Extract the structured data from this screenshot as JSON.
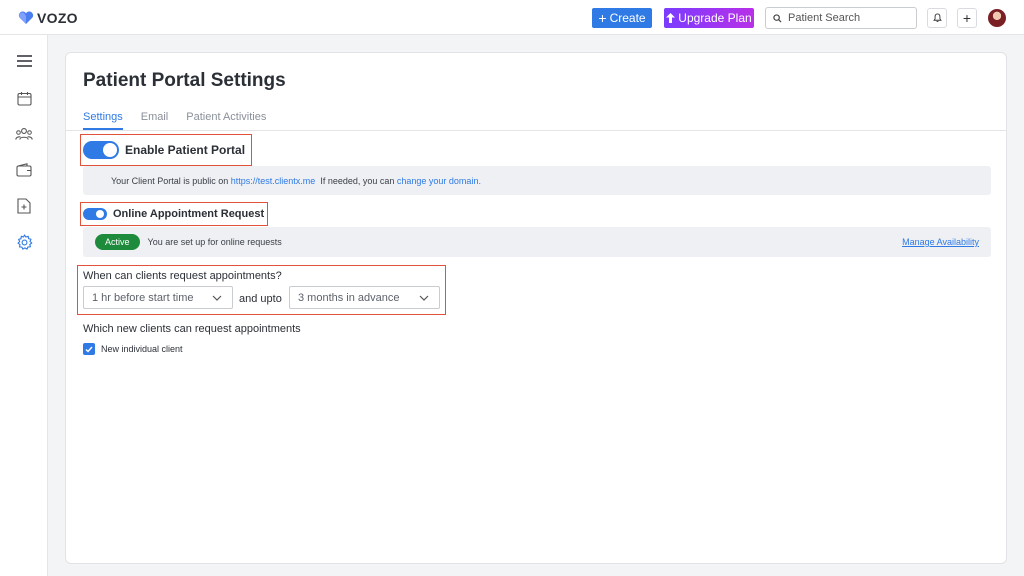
{
  "app": {
    "brand": "VOZO"
  },
  "header": {
    "create_label": "Create",
    "upgrade_label": "Upgrade Plan",
    "search_placeholder": "Patient Search"
  },
  "page": {
    "title": "Patient Portal Settings",
    "tabs": [
      {
        "label": "Settings",
        "active": true
      },
      {
        "label": "Email",
        "active": false
      },
      {
        "label": "Patient Activities",
        "active": false
      }
    ]
  },
  "portal": {
    "toggle_label": "Enable Patient Portal",
    "enabled": true,
    "info_prefix": "Your Client Portal is public on",
    "url": "https://test.clientx.me",
    "info_middle": "If needed, you can",
    "change_link": "change your domain."
  },
  "appointment": {
    "toggle_label": "Online Appointment Request",
    "enabled": true,
    "status_badge": "Active",
    "status_text": "You are set up for online requests",
    "manage_link": "Manage Availability"
  },
  "timing": {
    "question": "When can clients request appointments?",
    "start_value": "1 hr before start time",
    "connector": "and upto",
    "end_value": "3 months in advance"
  },
  "clients": {
    "question": "Which new clients can request appointments",
    "option_label": "New individual client",
    "option_checked": true
  },
  "colors": {
    "accent": "#2f7ae5",
    "upgrade_gradient_start": "#7a3cff",
    "upgrade_gradient_end": "#b830e8",
    "active_badge": "#1e8b3c",
    "highlight": "#e0533a"
  },
  "icons": {
    "sidebar": [
      "menu-icon",
      "calendar-icon",
      "users-icon",
      "wallet-icon",
      "document-plus-icon",
      "gear-icon"
    ],
    "header": [
      "bell-icon",
      "plus-icon",
      "search-icon"
    ]
  }
}
